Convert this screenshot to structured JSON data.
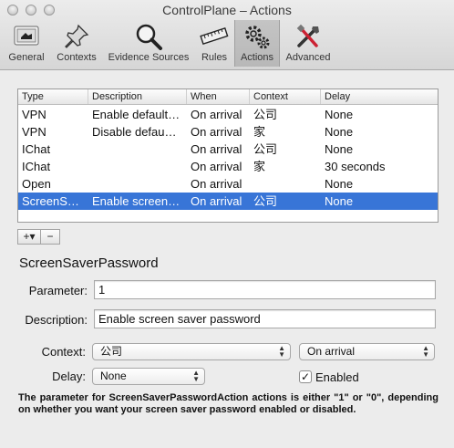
{
  "window": {
    "title": "ControlPlane – Actions"
  },
  "toolbar": {
    "items": [
      {
        "label": "General",
        "icon": "general-switch-icon"
      },
      {
        "label": "Contexts",
        "icon": "pushpin-icon"
      },
      {
        "label": "Evidence Sources",
        "icon": "magnifying-glass-icon"
      },
      {
        "label": "Rules",
        "icon": "ruler-icon"
      },
      {
        "label": "Actions",
        "icon": "gears-icon",
        "selected": true
      },
      {
        "label": "Advanced",
        "icon": "tools-icon"
      }
    ]
  },
  "table": {
    "headers": [
      "Type",
      "Description",
      "When",
      "Context",
      "Delay"
    ],
    "rows": [
      {
        "type": "VPN",
        "description": "Enable default…",
        "when": "On arrival",
        "context": "公司",
        "delay": "None"
      },
      {
        "type": "VPN",
        "description": "Disable defau…",
        "when": "On arrival",
        "context": "家",
        "delay": "None"
      },
      {
        "type": "IChat",
        "description": "",
        "when": "On arrival",
        "context": "公司",
        "delay": "None"
      },
      {
        "type": "IChat",
        "description": "",
        "when": "On arrival",
        "context": "家",
        "delay": "30 seconds"
      },
      {
        "type": "Open",
        "description": "",
        "when": "On arrival",
        "context": "",
        "delay": "None"
      },
      {
        "type": "ScreenS…",
        "description": "Enable screen…",
        "when": "On arrival",
        "context": "公司",
        "delay": "None",
        "selected": true
      }
    ]
  },
  "buttons": {
    "add": "+▾",
    "remove": "−"
  },
  "detail": {
    "title": "ScreenSaverPassword",
    "parameter_label": "Parameter:",
    "parameter_value": "1",
    "description_label": "Description:",
    "description_value": "Enable screen saver password",
    "context_label": "Context:",
    "context_value": "公司",
    "when_value": "On arrival",
    "delay_label": "Delay:",
    "delay_value": "None",
    "enabled_label": "Enabled",
    "enabled_checked": "✓",
    "help_text": "The parameter for ScreenSaverPasswordAction actions is either \"1\" or \"0\", depending on whether you want your screen saver password enabled or disabled."
  },
  "colors": {
    "selection": "#3875d7",
    "window_bg": "#ececec"
  }
}
